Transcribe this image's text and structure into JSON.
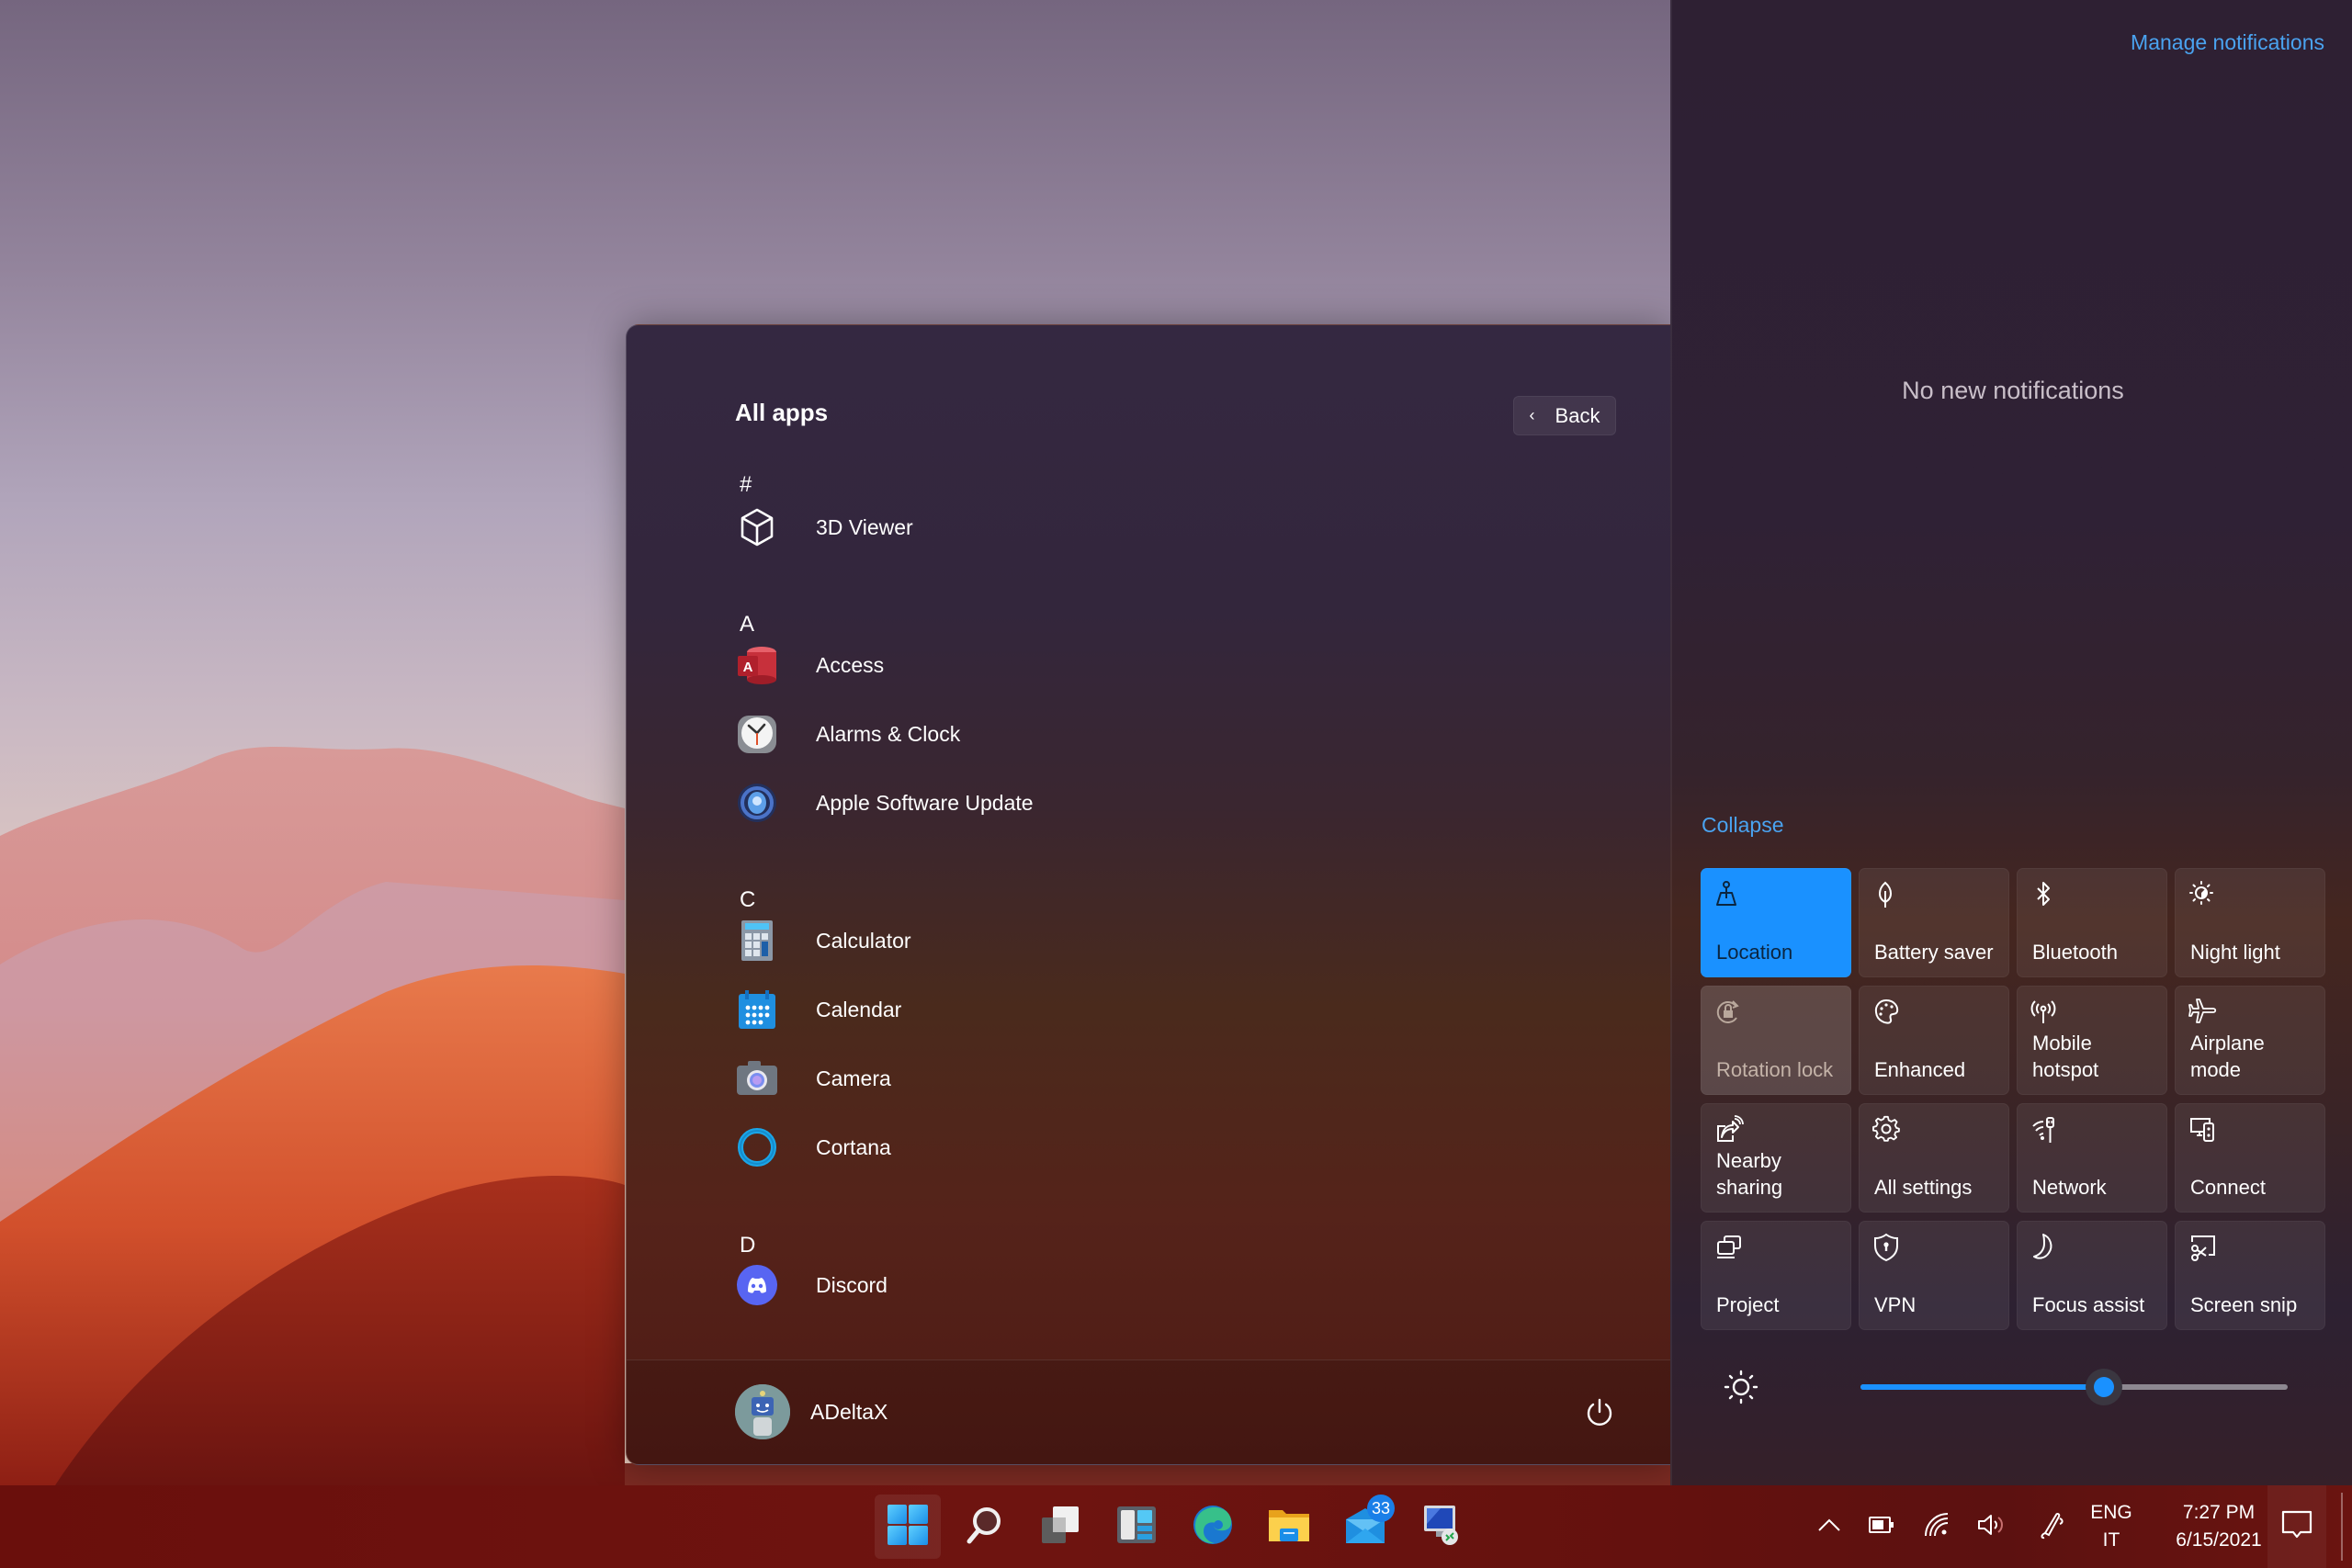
{
  "start_menu": {
    "title": "All apps",
    "back_label": "Back",
    "sections": [
      {
        "letter": "#",
        "apps": [
          {
            "name": "3D Viewer",
            "icon": "cube-icon"
          }
        ]
      },
      {
        "letter": "A",
        "apps": [
          {
            "name": "Access",
            "icon": "access-icon"
          },
          {
            "name": "Alarms & Clock",
            "icon": "clock-icon"
          },
          {
            "name": "Apple Software Update",
            "icon": "apple-update-icon"
          }
        ]
      },
      {
        "letter": "C",
        "apps": [
          {
            "name": "Calculator",
            "icon": "calculator-icon"
          },
          {
            "name": "Calendar",
            "icon": "calendar-icon"
          },
          {
            "name": "Camera",
            "icon": "camera-icon"
          },
          {
            "name": "Cortana",
            "icon": "cortana-icon"
          }
        ]
      },
      {
        "letter": "D",
        "apps": [
          {
            "name": "Discord",
            "icon": "discord-icon"
          }
        ]
      }
    ],
    "user": {
      "name": "ADeltaX",
      "avatar": "robot-avatar"
    },
    "power_icon": "power-icon"
  },
  "action_center": {
    "manage_label": "Manage notifications",
    "empty_label": "No new notifications",
    "collapse_label": "Collapse",
    "tiles": [
      {
        "label": "Location",
        "icon": "location-icon",
        "state": "active"
      },
      {
        "label": "Battery saver",
        "icon": "leaf-icon",
        "state": "off"
      },
      {
        "label": "Bluetooth",
        "icon": "bluetooth-icon",
        "state": "off"
      },
      {
        "label": "Night light",
        "icon": "night-light-icon",
        "state": "off"
      },
      {
        "label": "Rotation lock",
        "icon": "rotation-lock-icon",
        "state": "disabled"
      },
      {
        "label": "Enhanced",
        "icon": "palette-icon",
        "state": "off"
      },
      {
        "label": "Mobile hotspot",
        "icon": "hotspot-icon",
        "state": "off"
      },
      {
        "label": "Airplane mode",
        "icon": "airplane-icon",
        "state": "off"
      },
      {
        "label": "Nearby sharing",
        "icon": "nearby-sharing-icon",
        "state": "off"
      },
      {
        "label": "All settings",
        "icon": "gear-icon",
        "state": "off"
      },
      {
        "label": "Network",
        "icon": "network-icon",
        "state": "off"
      },
      {
        "label": "Connect",
        "icon": "connect-icon",
        "state": "off"
      },
      {
        "label": "Project",
        "icon": "project-icon",
        "state": "off"
      },
      {
        "label": "VPN",
        "icon": "vpn-shield-icon",
        "state": "off"
      },
      {
        "label": "Focus assist",
        "icon": "moon-icon",
        "state": "off"
      },
      {
        "label": "Screen snip",
        "icon": "screen-snip-icon",
        "state": "off"
      }
    ],
    "brightness": {
      "value_percent": 57
    },
    "accent_color": "#1a91ff",
    "link_color": "#4aa3f0"
  },
  "taskbar": {
    "apps": [
      {
        "name": "Start",
        "icon": "windows-logo-icon",
        "active": true
      },
      {
        "name": "Search",
        "icon": "search-icon"
      },
      {
        "name": "Task View",
        "icon": "task-view-icon"
      },
      {
        "name": "Widgets",
        "icon": "widgets-icon"
      },
      {
        "name": "Microsoft Edge",
        "icon": "edge-icon"
      },
      {
        "name": "File Explorer",
        "icon": "folder-icon"
      },
      {
        "name": "Mail",
        "icon": "mail-icon",
        "badge": "33"
      },
      {
        "name": "Remote Desktop",
        "icon": "remote-desktop-icon"
      }
    ],
    "tray": {
      "icons": [
        "chevron-up-icon",
        "battery-icon",
        "wifi-icon",
        "volume-icon",
        "pen-icon"
      ],
      "language_line1": "ENG",
      "language_line2": "IT",
      "time": "7:27 PM",
      "date": "6/15/2021"
    }
  }
}
